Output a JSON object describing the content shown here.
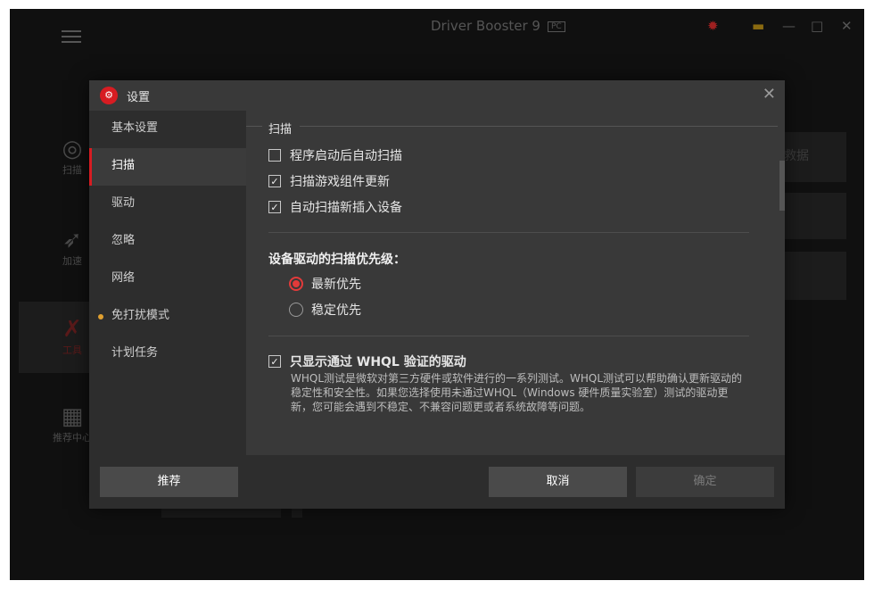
{
  "app": {
    "title": "Driver Booster 9",
    "title_badge": "PC",
    "left_nav": [
      "扫描",
      "加速",
      "工具",
      "推荐中心"
    ],
    "bg_panel_text": "救据"
  },
  "dialog": {
    "title": "设置",
    "sidebar": [
      {
        "label": "基本设置",
        "active": false,
        "dot": false
      },
      {
        "label": "扫描",
        "active": true,
        "dot": false
      },
      {
        "label": "驱动",
        "active": false,
        "dot": false
      },
      {
        "label": "忽略",
        "active": false,
        "dot": false
      },
      {
        "label": "网络",
        "active": false,
        "dot": false
      },
      {
        "label": "免打扰模式",
        "active": false,
        "dot": true
      },
      {
        "label": "计划任务",
        "active": false,
        "dot": false
      }
    ],
    "scan": {
      "section_title": "扫描",
      "options": [
        {
          "label": "程序启动后自动扫描",
          "checked": false
        },
        {
          "label": "扫描游戏组件更新",
          "checked": true
        },
        {
          "label": "自动扫描新插入设备",
          "checked": true
        }
      ],
      "priority_label": "设备驱动的扫描优先级：",
      "priority_options": [
        {
          "label": "最新优先",
          "selected": true
        },
        {
          "label": "稳定优先",
          "selected": false
        }
      ],
      "whql_label": "只显示通过 WHQL 验证的驱动",
      "whql_checked": true,
      "whql_desc": "WHQL测试是微软对第三方硬件或软件进行的一系列测试。WHQL测试可以帮助确认更新驱动的稳定性和安全性。如果您选择使用未通过WHQL（Windows 硬件质量实验室）测试的驱动更新，您可能会遇到不稳定、不兼容问题更或者系统故障等问题。"
    },
    "footer": {
      "recommend_label": "推荐",
      "cancel_label": "取消",
      "ok_label": "确定"
    }
  },
  "colors": {
    "accent": "#d71c22",
    "radio_active": "#e23a3a",
    "dot": "#e0a030"
  }
}
